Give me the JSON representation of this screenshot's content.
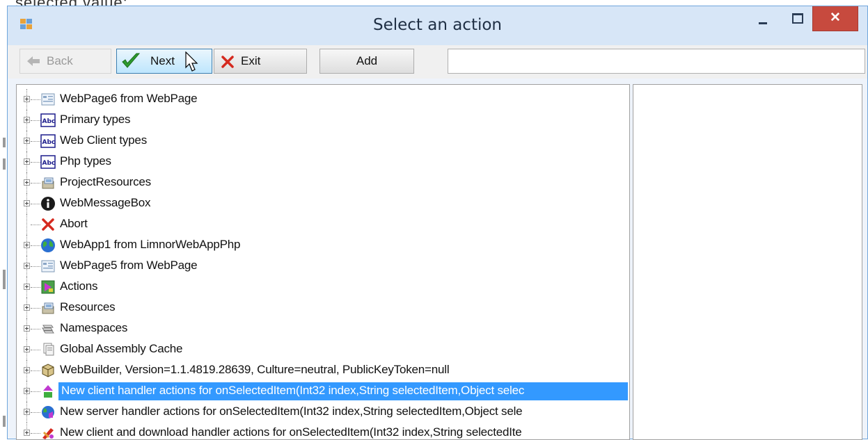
{
  "background": {
    "cut_text": "selected value:"
  },
  "window": {
    "title": "Select an action",
    "minimize_label": "",
    "maximize_label": ""
  },
  "toolbar": {
    "back_label": "Back",
    "next_label": "Next",
    "exit_label": "Exit",
    "add_label": "Add",
    "input_value": ""
  },
  "tree": {
    "items": [
      {
        "label": "WebPage6 from WebPage",
        "icon": "webpage-icon",
        "expandable": true
      },
      {
        "label": "Primary types",
        "icon": "abc-type-icon",
        "expandable": true
      },
      {
        "label": "Web Client types",
        "icon": "abc-type-icon",
        "expandable": true
      },
      {
        "label": "Php types",
        "icon": "abc-type-icon",
        "expandable": true
      },
      {
        "label": "ProjectResources",
        "icon": "resources-icon",
        "expandable": true
      },
      {
        "label": "WebMessageBox",
        "icon": "info-icon",
        "expandable": true
      },
      {
        "label": "Abort",
        "icon": "red-x-icon",
        "expandable": false
      },
      {
        "label": "WebApp1 from LimnorWebAppPhp",
        "icon": "globe-icon",
        "expandable": true
      },
      {
        "label": "WebPage5 from WebPage",
        "icon": "webpage-icon",
        "expandable": true
      },
      {
        "label": "Actions",
        "icon": "actions-icon",
        "expandable": true
      },
      {
        "label": "Resources",
        "icon": "resources-icon",
        "expandable": true
      },
      {
        "label": "Namespaces",
        "icon": "namespaces-icon",
        "expandable": true
      },
      {
        "label": "Global Assembly Cache",
        "icon": "assembly-cache-icon",
        "expandable": true
      },
      {
        "label": "WebBuilder, Version=1.1.4819.28639, Culture=neutral, PublicKeyToken=null",
        "icon": "package-icon",
        "expandable": true
      },
      {
        "label": "New client handler actions for onSelectedItem(Int32 index,String selectedItem,Object selec",
        "icon": "client-handler-icon",
        "expandable": true,
        "selected": true
      },
      {
        "label": "New server handler actions for onSelectedItem(Int32 index,String selectedItem,Object sele",
        "icon": "server-handler-icon",
        "expandable": true
      },
      {
        "label": "New client and download handler actions for onSelectedItem(Int32 index,String selectedIte",
        "icon": "download-handler-icon",
        "expandable": true
      }
    ]
  },
  "colors": {
    "selection": "#3399ff",
    "close_button": "#c74a3e",
    "titlebar": "#d7e6f7",
    "window_border": "#6fa6dc"
  }
}
